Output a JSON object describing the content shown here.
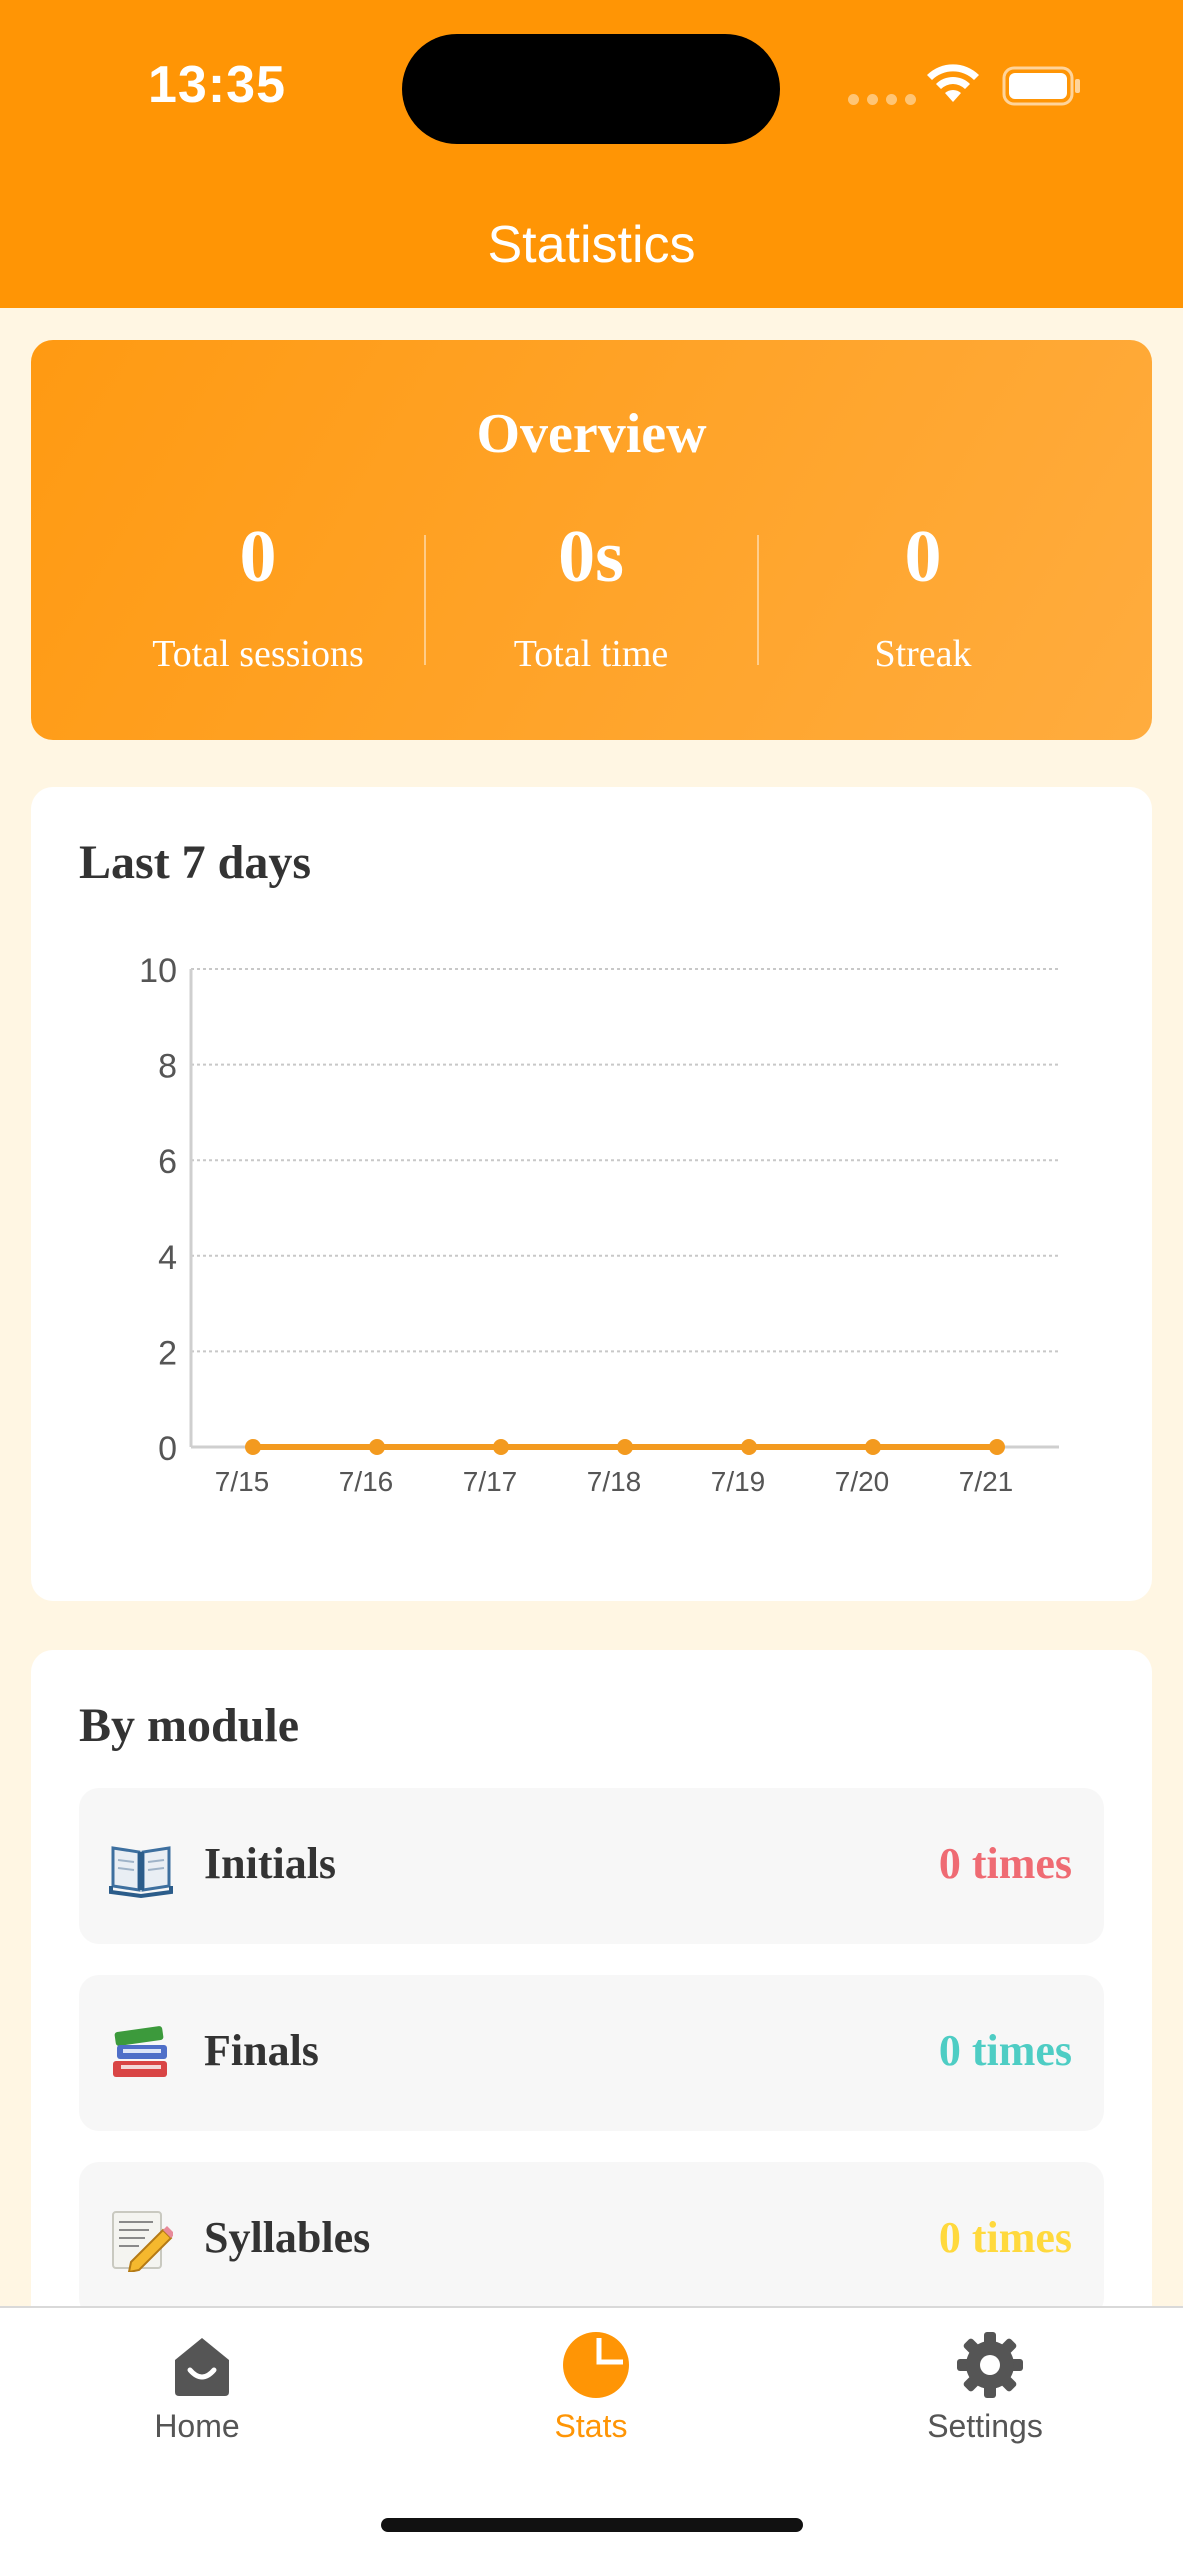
{
  "status_bar": {
    "time": "13:35"
  },
  "header": {
    "title": "Statistics"
  },
  "overview": {
    "title": "Overview",
    "stats": [
      {
        "value": "0",
        "label": "Total sessions"
      },
      {
        "value": "0s",
        "label": "Total time"
      },
      {
        "value": "0",
        "label": "Streak"
      }
    ]
  },
  "weekly": {
    "title": "Last 7 days"
  },
  "chart_data": {
    "type": "line",
    "title": "",
    "xlabel": "",
    "ylabel": "",
    "categories": [
      "7/15",
      "7/16",
      "7/17",
      "7/18",
      "7/19",
      "7/20",
      "7/21"
    ],
    "values": [
      0,
      0,
      0,
      0,
      0,
      0,
      0
    ],
    "ylim": [
      0,
      10
    ],
    "yticks": [
      "0",
      "2",
      "4",
      "6",
      "8",
      "10"
    ],
    "grid": true,
    "color": "#f39a1f"
  },
  "modules": {
    "title": "By module",
    "items": [
      {
        "icon": "open-book-icon",
        "name": "Initials",
        "count": "0 times",
        "color": "#ef6b73"
      },
      {
        "icon": "books-stack-icon",
        "name": "Finals",
        "count": "0 times",
        "color": "#4ecdc4"
      },
      {
        "icon": "memo-pencil-icon",
        "name": "Syllables",
        "count": "0 times",
        "color": "#ffd93d"
      }
    ]
  },
  "tab_bar": {
    "tabs": [
      {
        "label": "Home",
        "icon": "home-icon",
        "active": false
      },
      {
        "label": "Stats",
        "icon": "pie-chart-icon",
        "active": true
      },
      {
        "label": "Settings",
        "icon": "gear-icon",
        "active": false
      }
    ],
    "active_color": "#ff9505",
    "inactive_color": "#555555"
  }
}
